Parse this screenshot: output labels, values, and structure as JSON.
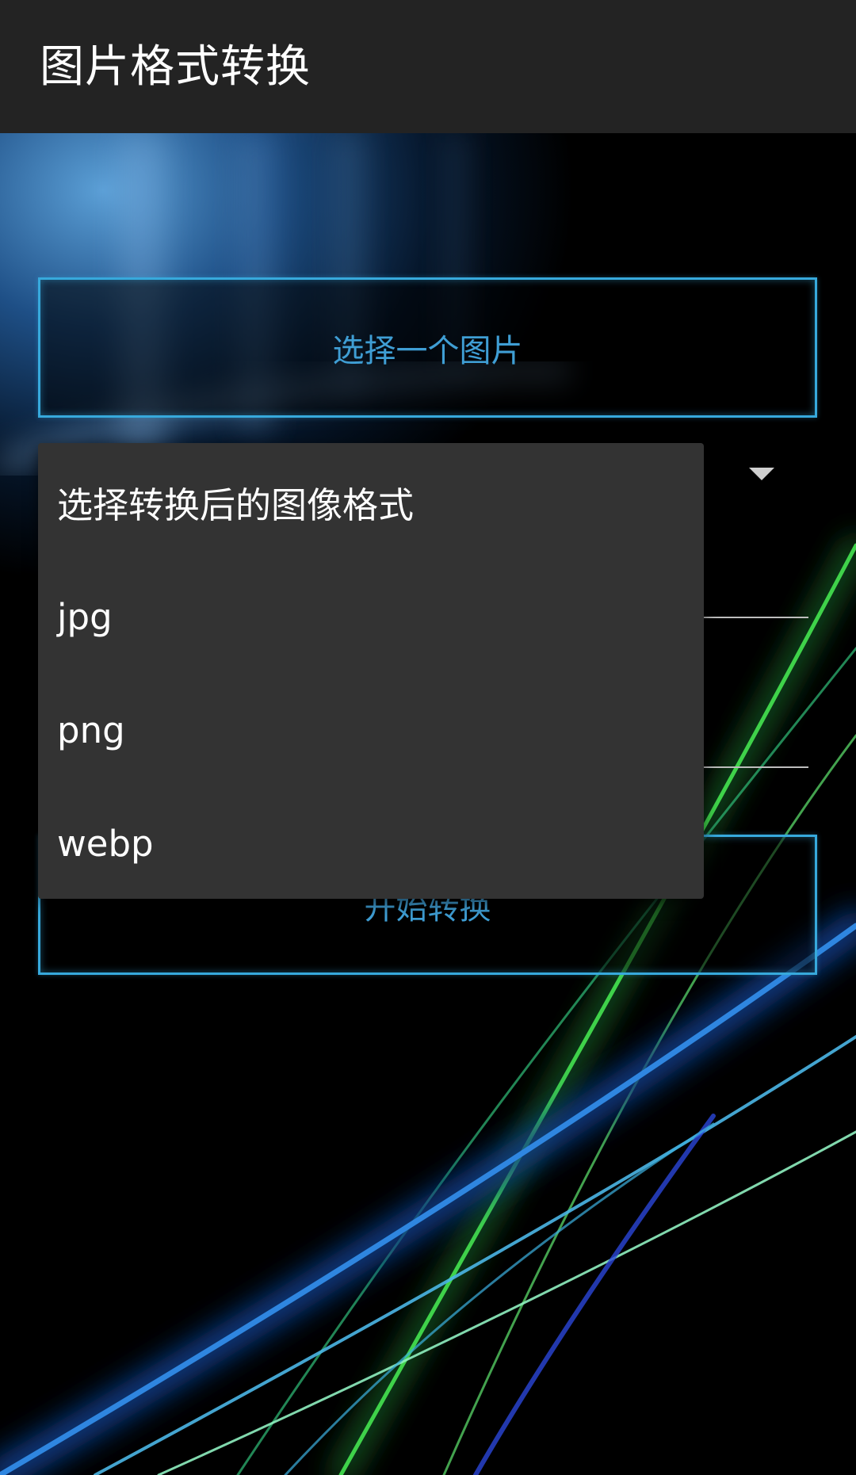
{
  "app_bar": {
    "title": "图片格式转换"
  },
  "buttons": {
    "select_image": "选择一个图片",
    "start_convert": "开始转换"
  },
  "format_dropdown": {
    "options": [
      "选择转换后的图像格式",
      "jpg",
      "png",
      "webp"
    ]
  },
  "colors": {
    "accent": "#37a9dc",
    "button_text": "#3f9ed4",
    "app_bar": "#232323",
    "menu_background": "#333333"
  },
  "icons": {
    "spinner": "caret-down-icon"
  }
}
